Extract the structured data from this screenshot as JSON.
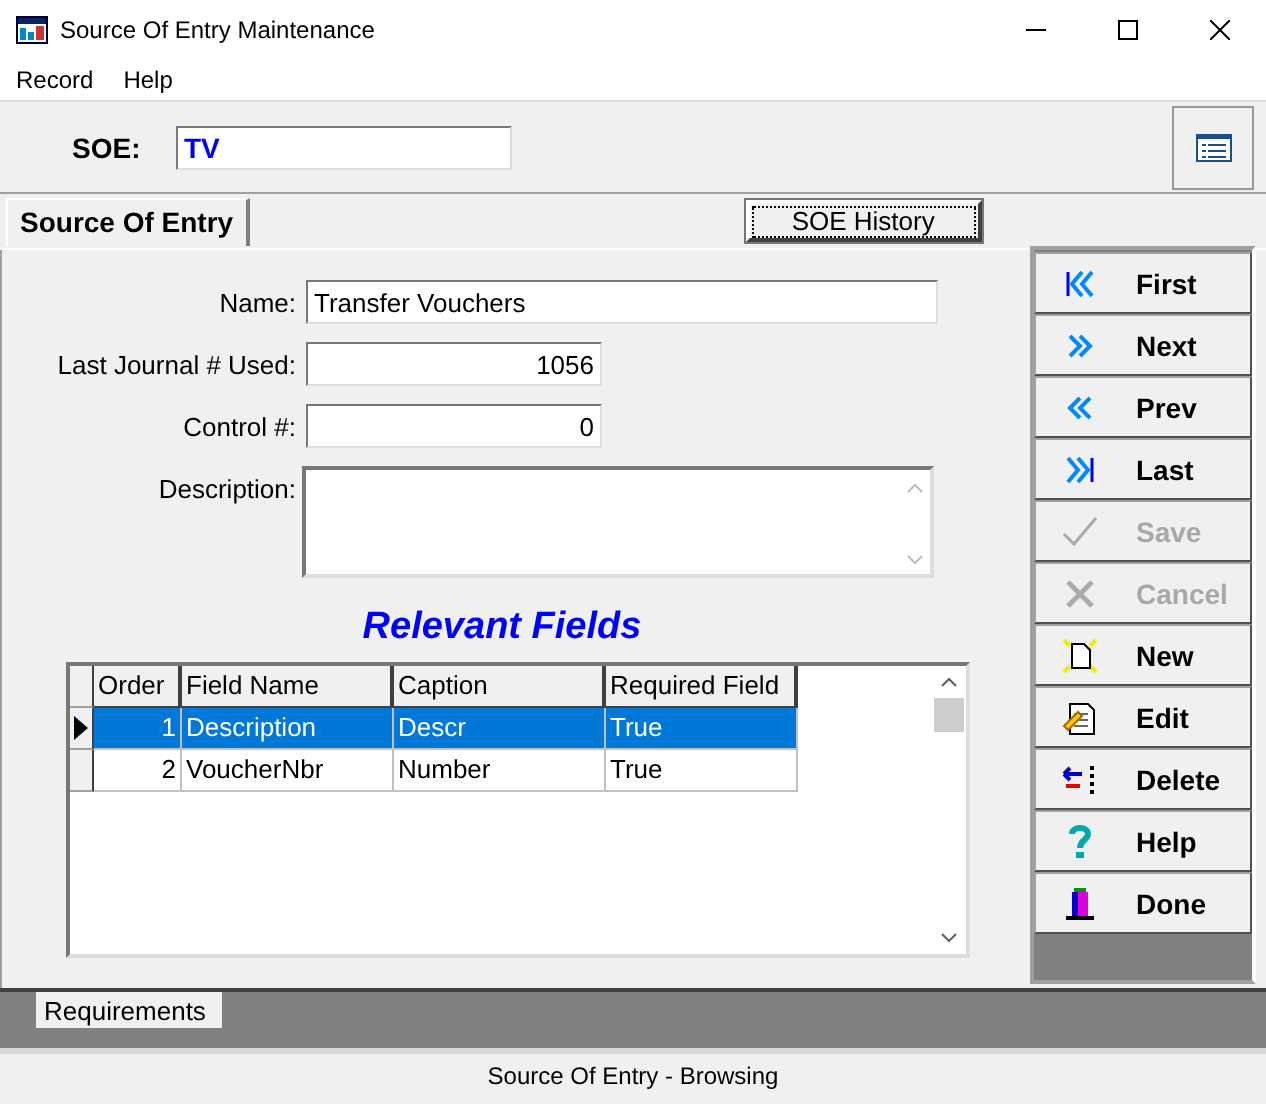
{
  "window": {
    "title": "Source Of Entry Maintenance"
  },
  "menu": [
    "Record",
    "Help"
  ],
  "soe": {
    "label": "SOE:",
    "value": "TV"
  },
  "tabs": [
    {
      "label": "Source Of Entry",
      "selected": true
    }
  ],
  "history_button": "SOE History",
  "form": [
    {
      "label": "Name:",
      "value": "Transfer Vouchers",
      "kind": "text"
    },
    {
      "label": "Last Journal # Used:",
      "value": "1056",
      "kind": "number"
    },
    {
      "label": "Control #:",
      "value": "0",
      "kind": "number"
    },
    {
      "label": "Description:",
      "kind": "memo"
    }
  ],
  "section_title": "Relevant Fields",
  "table": {
    "columns": [
      "Order",
      "Field Name",
      "Caption",
      "Required Field"
    ],
    "rows": [
      {
        "cells": [
          "1",
          "Description",
          "Descr",
          "True"
        ],
        "selected": true
      },
      {
        "cells": [
          "2",
          "VoucherNbr",
          "Number",
          "True"
        ],
        "selected": false
      }
    ]
  },
  "actions": [
    {
      "kind": "first",
      "label": "First",
      "disabled": false
    },
    {
      "kind": "next",
      "label": "Next",
      "disabled": false
    },
    {
      "kind": "prev",
      "label": "Prev",
      "disabled": false
    },
    {
      "kind": "last",
      "label": "Last",
      "disabled": false
    },
    {
      "kind": "save",
      "label": "Save",
      "disabled": true
    },
    {
      "kind": "cancel",
      "label": "Cancel",
      "disabled": true
    },
    {
      "kind": "new",
      "label": "New",
      "disabled": false
    },
    {
      "kind": "edit",
      "label": "Edit",
      "disabled": false
    },
    {
      "kind": "delete",
      "label": "Delete",
      "disabled": false
    },
    {
      "kind": "help",
      "label": "Help",
      "disabled": false
    },
    {
      "kind": "done",
      "label": "Done",
      "disabled": false
    }
  ],
  "bottom_tabs": [
    {
      "label": "Requirements",
      "selected": true
    }
  ],
  "status_bar": "Source Of Entry - Browsing"
}
